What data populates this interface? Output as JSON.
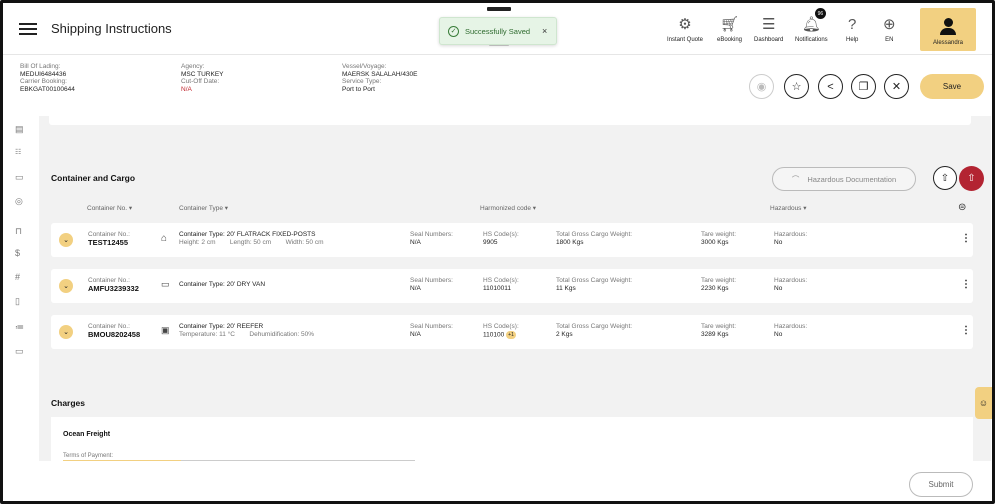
{
  "app": {
    "title": "Shipping Instructions"
  },
  "toast": {
    "text": "Successfully Saved",
    "close": "×"
  },
  "nav": [
    {
      "label": "Instant Quote",
      "icon": "quote-icon"
    },
    {
      "label": "eBooking",
      "icon": "cart-icon"
    },
    {
      "label": "Dashboard",
      "icon": "dashboard-icon"
    },
    {
      "label": "Notifications",
      "icon": "bell-icon",
      "badge": "96"
    },
    {
      "label": "Help",
      "icon": "help-icon"
    },
    {
      "label": "EN",
      "icon": "globe-icon"
    }
  ],
  "user": {
    "name": "Alessandra"
  },
  "shipment": {
    "bl_label": "Bill Of Lading:",
    "bl_value": "MEDUI6484436",
    "carrier_label": "Carrier Booking:",
    "carrier_value": "EBKGAT00100644",
    "agency_label": "Agency:",
    "agency_value": "MSC TURKEY",
    "cutoff_label": "Cut-Off Date:",
    "cutoff_value": "N/A",
    "vessel_label": "Vessel/Voyage:",
    "vessel_value": "MAERSK SALALAH/430E",
    "service_label": "Service Type:",
    "service_value": "Port to Port"
  },
  "actions": {
    "save": "Save",
    "submit": "Submit"
  },
  "container_section": {
    "title": "Container and Cargo",
    "hazardous_doc": "Hazardous Documentation",
    "columns": {
      "container_no": "Container No. ▾",
      "container_type": "Container Type ▾",
      "hs_code": "Harmonized code ▾",
      "hazardous": "Hazardous ▾"
    },
    "rows": [
      {
        "no_label": "Container No.:",
        "no": "TEST12455",
        "type": "Container Type: 20' FLATRACK FIXED-POSTS",
        "dims": "Height: 2 cm        Length: 50 cm        Width: 50 cm",
        "seal_label": "Seal Numbers:",
        "seal": "N/A",
        "hs_label": "HS Code(s):",
        "hs": "9905",
        "hs_more": "",
        "gross_label": "Total Gross Cargo Weight:",
        "gross": "1800 Kgs",
        "tare_label": "Tare weight:",
        "tare": "3000 Kgs",
        "haz_label": "Hazardous:",
        "haz": "No"
      },
      {
        "no_label": "Container No.:",
        "no": "AMFU3239332",
        "type": "Container Type: 20' DRY VAN",
        "dims": "",
        "seal_label": "Seal Numbers:",
        "seal": "N/A",
        "hs_label": "HS Code(s):",
        "hs": "11010011",
        "hs_more": "",
        "gross_label": "Total Gross Cargo Weight:",
        "gross": "11 Kgs",
        "tare_label": "Tare weight:",
        "tare": "2230 Kgs",
        "haz_label": "Hazardous:",
        "haz": "No"
      },
      {
        "no_label": "Container No.:",
        "no": "BMOU8202458",
        "type": "Container Type: 20' REEFER",
        "dims": "Temperature: 11 °C        Dehumidification: 50%",
        "seal_label": "Seal Numbers:",
        "seal": "N/A",
        "hs_label": "HS Code(s):",
        "hs": "110100",
        "hs_more": "+1",
        "gross_label": "Total Gross Cargo Weight:",
        "gross": "2 Kgs",
        "tare_label": "Tare weight:",
        "tare": "3289 Kgs",
        "haz_label": "Hazardous:",
        "haz": "No"
      }
    ]
  },
  "charges": {
    "title": "Charges",
    "ocean": "Ocean Freight",
    "terms_label": "Terms of Payment:"
  }
}
